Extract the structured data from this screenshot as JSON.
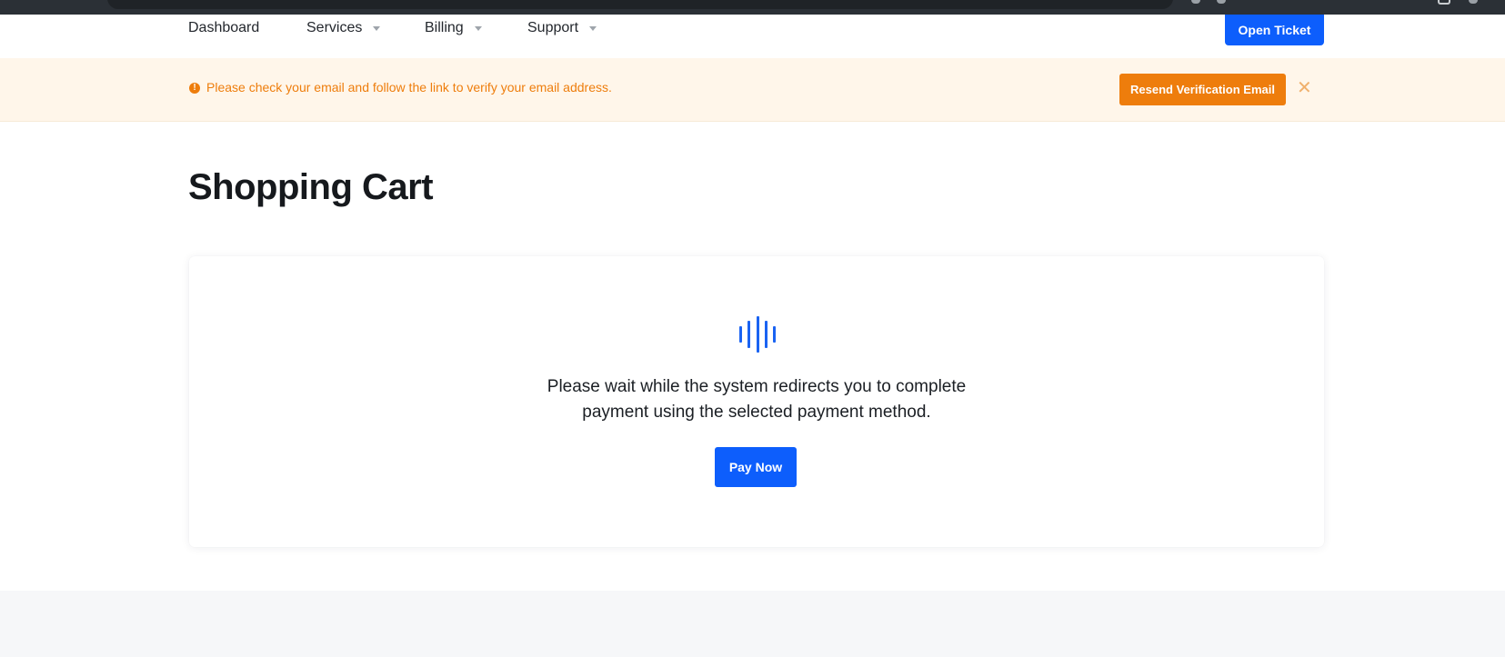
{
  "nav": {
    "items": [
      {
        "label": "Dashboard",
        "dropdown": false
      },
      {
        "label": "Services",
        "dropdown": true
      },
      {
        "label": "Billing",
        "dropdown": true
      },
      {
        "label": "Support",
        "dropdown": true
      }
    ],
    "open_ticket_label": "Open Ticket"
  },
  "alert": {
    "icon": "exclamation-circle-icon",
    "message": "Please check your email and follow the link to verify your email address.",
    "resend_label": "Resend Verification Email",
    "close_glyph": "✕"
  },
  "page": {
    "title": "Shopping Cart"
  },
  "redirect": {
    "loader_icon": "audio-bars-loader-icon",
    "message_line1": "Please wait while the system redirects you to complete",
    "message_line2": "payment using the selected payment method.",
    "pay_now_label": "Pay Now"
  },
  "colors": {
    "primary": "#0d5efc",
    "warning": "#ee7d0c",
    "warning_bg": "#fff6ea",
    "footer_bg": "#f6f7f9"
  }
}
